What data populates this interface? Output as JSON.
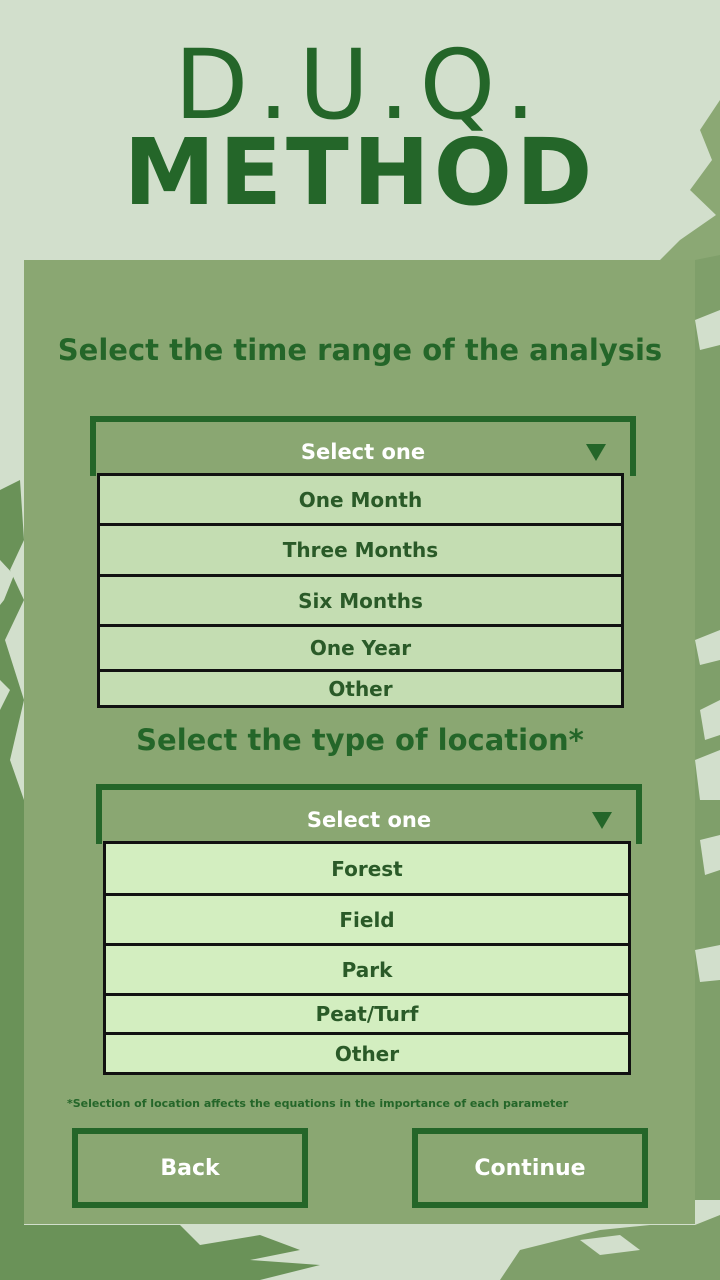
{
  "colors": {
    "background": "#d2dfcc",
    "panel": "#8aa772",
    "accent": "#246629",
    "option_bg_time": "#c4ddb2",
    "option_bg_location": "#d3eec0",
    "foliage": "#6a9258"
  },
  "title": {
    "line1": "D.U.Q.",
    "line2": "METHOD"
  },
  "time_section": {
    "heading": "Select the time range of the analysis",
    "select_placeholder": "Select one",
    "caret_icon": "triangle-down-icon",
    "options": [
      "One Month",
      "Three Months",
      "Six Months",
      "One Year",
      "Other"
    ]
  },
  "location_section": {
    "heading": "Select the type of location*",
    "select_placeholder": "Select one",
    "caret_icon": "triangle-down-icon",
    "options": [
      "Forest",
      "Field",
      "Park",
      "Peat/Turf",
      "Other"
    ]
  },
  "note": "*Selection  of location affects the equations  in the importance of each parameter",
  "buttons": {
    "back": "Back",
    "continue": "Continue"
  }
}
